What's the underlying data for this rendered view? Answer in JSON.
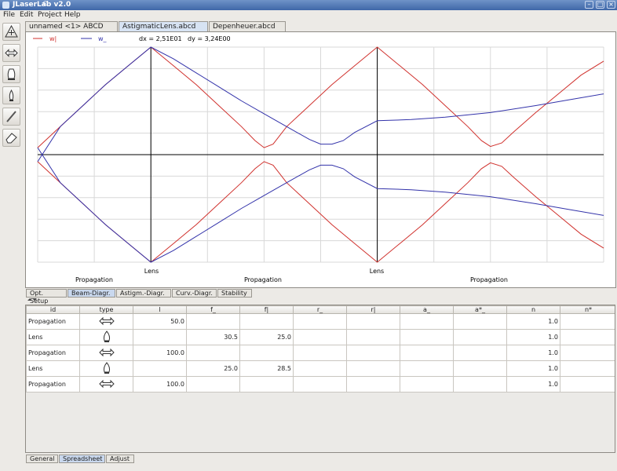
{
  "window": {
    "app_icon": "app-icon",
    "title": "JLaserLab v2.0",
    "title_extra": "⊙",
    "controls": [
      "minimize-icon",
      "maximize-icon",
      "close-icon"
    ]
  },
  "menu": {
    "items": [
      "File",
      "Edit",
      "Project",
      "Help"
    ]
  },
  "toolbar": {
    "tools": [
      "add-element-icon",
      "propagation-icon",
      "thick-lens-icon",
      "thin-lens-icon",
      "mirror-icon",
      "eraser-icon"
    ]
  },
  "file_tabs": [
    {
      "label": "unnamed <1> ABCD",
      "active": false
    },
    {
      "label": "AstigmaticLens.abcd",
      "active": true
    },
    {
      "label": "Depenheuer.abcd",
      "active": false
    }
  ],
  "plot": {
    "legend": [
      {
        "label": "w|",
        "color": "#d0312d"
      },
      {
        "label": "w_",
        "color": "#3333aa"
      }
    ],
    "dx": "dx = 2,51E01",
    "dy": "dy = 3,24E00",
    "section_labels": [
      {
        "text": "Propagation"
      },
      {
        "text": "Lens"
      },
      {
        "text": "Propagation"
      },
      {
        "text": "Lens"
      },
      {
        "text": "Propagation"
      }
    ]
  },
  "chart_data": {
    "type": "line",
    "title": "",
    "xlabel": "",
    "ylabel": "",
    "x_elements": [
      {
        "name": "Propagation",
        "length": 50
      },
      {
        "name": "Lens",
        "length": 0
      },
      {
        "name": "Propagation",
        "length": 100
      },
      {
        "name": "Lens",
        "length": 0
      },
      {
        "name": "Propagation",
        "length": 100
      }
    ],
    "xlim": [
      0,
      250
    ],
    "ylim": [
      -4.6,
      4.6
    ],
    "series": [
      {
        "name": "w|",
        "color": "#d0312d",
        "points": [
          [
            0,
            0.3
          ],
          [
            10,
            1.2
          ],
          [
            20,
            2.1
          ],
          [
            30,
            3.0
          ],
          [
            40,
            3.8
          ],
          [
            50,
            4.6
          ],
          [
            60,
            3.8
          ],
          [
            70,
            3.0
          ],
          [
            80,
            2.1
          ],
          [
            90,
            1.2
          ],
          [
            96,
            0.6
          ],
          [
            100,
            0.3
          ],
          [
            104,
            0.45
          ],
          [
            110,
            1.2
          ],
          [
            120,
            2.1
          ],
          [
            130,
            3.0
          ],
          [
            140,
            3.8
          ],
          [
            150,
            4.6
          ],
          [
            160,
            3.8
          ],
          [
            170,
            3.0
          ],
          [
            180,
            2.1
          ],
          [
            190,
            1.2
          ],
          [
            196,
            0.6
          ],
          [
            200,
            0.35
          ],
          [
            205,
            0.5
          ],
          [
            210,
            0.95
          ],
          [
            220,
            1.8
          ],
          [
            230,
            2.6
          ],
          [
            240,
            3.4
          ],
          [
            250,
            4.0
          ]
        ]
      },
      {
        "name": "w_",
        "color": "#3333aa",
        "points": [
          [
            0,
            -0.3
          ],
          [
            10,
            1.2
          ],
          [
            20,
            2.1
          ],
          [
            30,
            3.0
          ],
          [
            40,
            3.8
          ],
          [
            50,
            4.6
          ],
          [
            60,
            4.1
          ],
          [
            70,
            3.5
          ],
          [
            80,
            2.9
          ],
          [
            90,
            2.3
          ],
          [
            100,
            1.75
          ],
          [
            110,
            1.2
          ],
          [
            120,
            0.65
          ],
          [
            125,
            0.45
          ],
          [
            130,
            0.45
          ],
          [
            135,
            0.6
          ],
          [
            140,
            0.95
          ],
          [
            150,
            1.45
          ],
          [
            165,
            1.5
          ],
          [
            180,
            1.6
          ],
          [
            200,
            1.8
          ],
          [
            220,
            2.1
          ],
          [
            235,
            2.35
          ],
          [
            250,
            2.6
          ]
        ]
      }
    ]
  },
  "bottom_tabs": [
    {
      "label": "Opt. Setup",
      "active": false
    },
    {
      "label": "Beam-Diagr.",
      "active": true
    },
    {
      "label": "Astigm.-Diagr.",
      "active": false
    },
    {
      "label": "Curv.-Diagr.",
      "active": false
    },
    {
      "label": "Stability",
      "active": false
    }
  ],
  "table": {
    "columns": [
      "id",
      "type",
      "l",
      "f_",
      "f|",
      "r_",
      "r|",
      "a_",
      "a*_",
      "n",
      "n*"
    ],
    "rows": [
      {
        "id": "Propagation",
        "type_icon": "propagation-icon",
        "l": "50.0",
        "f_": "",
        "f|": "",
        "n": "1.0"
      },
      {
        "id": "Lens",
        "type_icon": "lens-icon",
        "l": "",
        "f_": "30.5",
        "f|": "25.0",
        "n": "1.0"
      },
      {
        "id": "Propagation",
        "type_icon": "propagation-icon",
        "l": "100.0",
        "f_": "",
        "f|": "",
        "n": "1.0"
      },
      {
        "id": "Lens",
        "type_icon": "lens-icon",
        "l": "",
        "f_": "25.0",
        "f|": "28.5",
        "n": "1.0"
      },
      {
        "id": "Propagation",
        "type_icon": "propagation-icon",
        "l": "100.0",
        "f_": "",
        "f|": "",
        "n": "1.0"
      }
    ]
  },
  "footer_tabs": [
    {
      "label": "General",
      "active": false
    },
    {
      "label": "Spreadsheet",
      "active": true
    },
    {
      "label": "Adjust",
      "active": false
    }
  ]
}
